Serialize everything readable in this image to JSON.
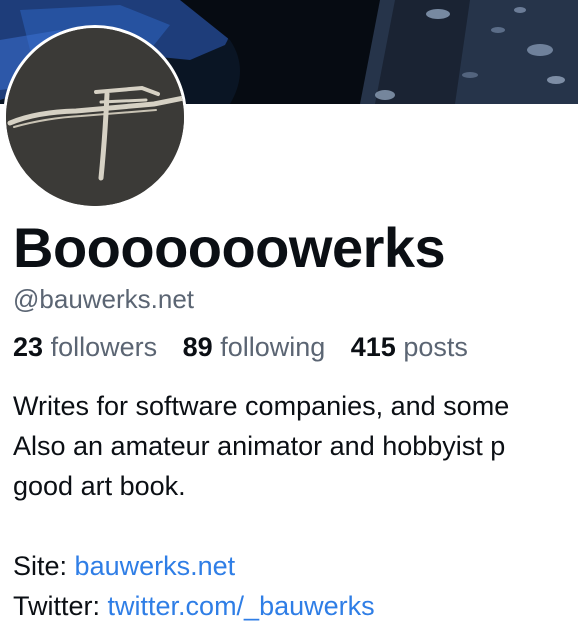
{
  "profile": {
    "display_name": "Booooooowerks",
    "handle": "@bauwerks.net",
    "stats": [
      {
        "count": "23",
        "label": "followers"
      },
      {
        "count": "89",
        "label": "following"
      },
      {
        "count": "415",
        "label": "posts"
      }
    ],
    "bio_lines": [
      "Writes for software companies, and some",
      "Also an amateur animator and hobbyist p",
      "good art book."
    ],
    "site_label": "Site:",
    "site_link": "bauwerks.net",
    "twitter_label": "Twitter:",
    "twitter_link": "twitter.com/_bauwerks"
  },
  "colors": {
    "link": "#2f7ee6",
    "muted": "#5b6573",
    "avatar_bg": "#3b3a37",
    "banner_bg": "#0a1524"
  }
}
